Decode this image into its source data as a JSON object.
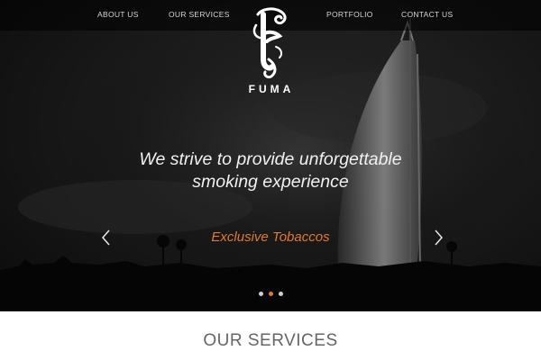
{
  "nav": {
    "items": [
      {
        "label": "ABOUT US"
      },
      {
        "label": "OUR SERVICES"
      },
      {
        "label": "PORTFOLIO"
      },
      {
        "label": "CONTACT US"
      }
    ]
  },
  "brand": {
    "name": "FUMA",
    "logo_icon": "smoke-f-logo-icon"
  },
  "hero": {
    "tagline_line1": "We strive to provide unforgettable",
    "tagline_line2": "smoking experience",
    "subtitle": "Exclusive Tobaccos",
    "prev_icon": "chevron-left-icon",
    "next_icon": "chevron-right-icon",
    "slides_total": 3,
    "active_slide": 2
  },
  "services": {
    "title": "OUR SERVICES"
  },
  "colors": {
    "accent": "#e07a2b",
    "hero_bg": "#141414",
    "nav_text": "#d6d6d6"
  }
}
